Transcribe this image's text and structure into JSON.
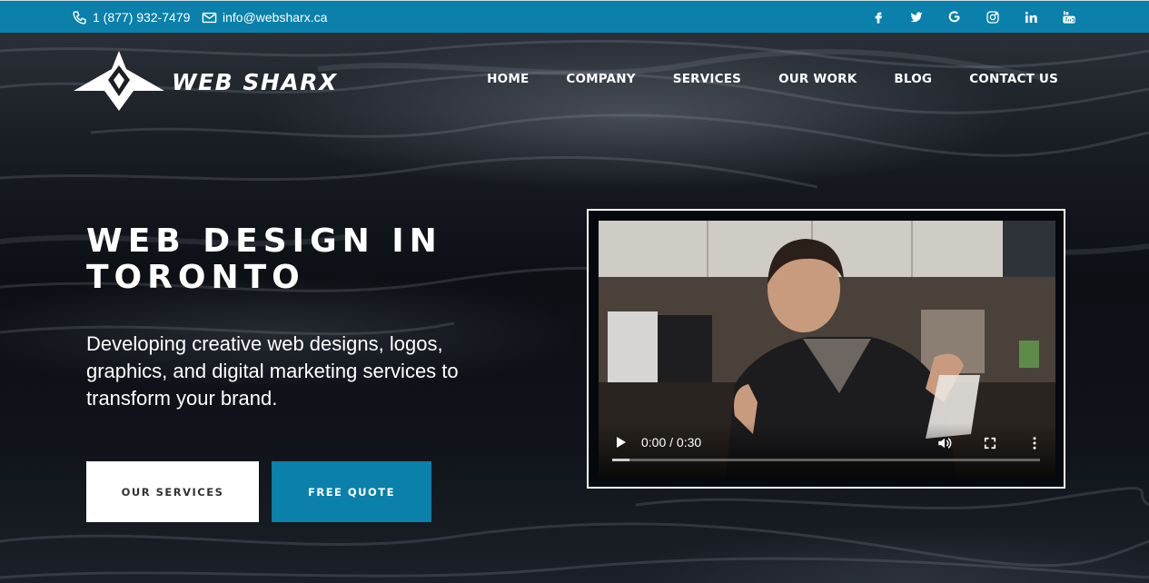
{
  "topbar": {
    "phone": "1 (877) 932-7479",
    "email": "info@websharx.ca",
    "socials": [
      "facebook-icon",
      "twitter-icon",
      "google-icon",
      "instagram-icon",
      "linkedin-icon",
      "youtube-icon"
    ],
    "background": "#0a80ab"
  },
  "header": {
    "logo_text": "WEB SHARX",
    "nav": [
      "HOME",
      "COMPANY",
      "SERVICES",
      "OUR WORK",
      "BLOG",
      "CONTACT US"
    ]
  },
  "hero": {
    "title_line1": "WEB DESIGN IN",
    "title_line2": "TORONTO",
    "subtitle": "Developing creative web designs, logos, graphics, and digital marketing services to transform your brand.",
    "buttons": {
      "services": "OUR SERVICES",
      "quote": "FREE QUOTE"
    }
  },
  "video": {
    "time": "0:00 / 0:30",
    "progress": 0.04
  },
  "colors": {
    "accent": "#0a80ab",
    "dark": "#0b0d12"
  }
}
